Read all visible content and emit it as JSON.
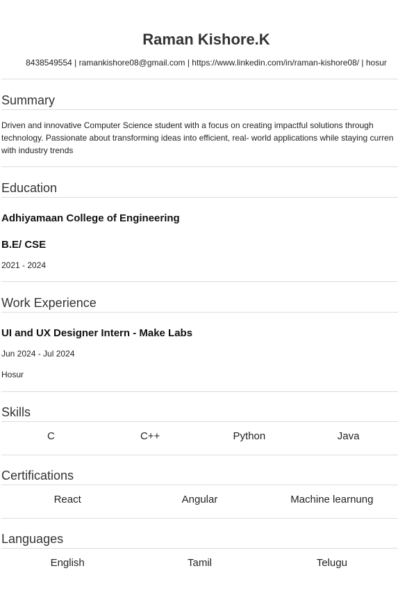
{
  "header": {
    "name": "Raman Kishore.K",
    "contact": "8438549554 | ramankishore08@gmail.com | https://www.linkedin.com/in/raman-kishore08/ | hosur"
  },
  "summary": {
    "title": "Summary",
    "lines": [
      "Driven and innovative Computer Science student with a focus on creating impactful solutions through",
      "technology. Passionate about transforming ideas into efficient, real- world applications while staying curren",
      "with industry trends"
    ]
  },
  "education": {
    "title": "Education",
    "institution": "Adhiyamaan College of Engineering",
    "degree": "B.E/ CSE",
    "years": "2021 - 2024"
  },
  "work": {
    "title": "Work Experience",
    "role": "UI and UX Designer Intern - Make Labs",
    "dates": "Jun 2024 - Jul 2024",
    "location": "Hosur"
  },
  "skills": {
    "title": "Skills",
    "items": [
      "C",
      "C++",
      "Python",
      "Java"
    ]
  },
  "certifications": {
    "title": "Certifications",
    "items": [
      "React",
      "Angular",
      "Machine learnung"
    ]
  },
  "languages": {
    "title": "Languages",
    "items": [
      "English",
      "Tamil",
      "Telugu"
    ]
  }
}
